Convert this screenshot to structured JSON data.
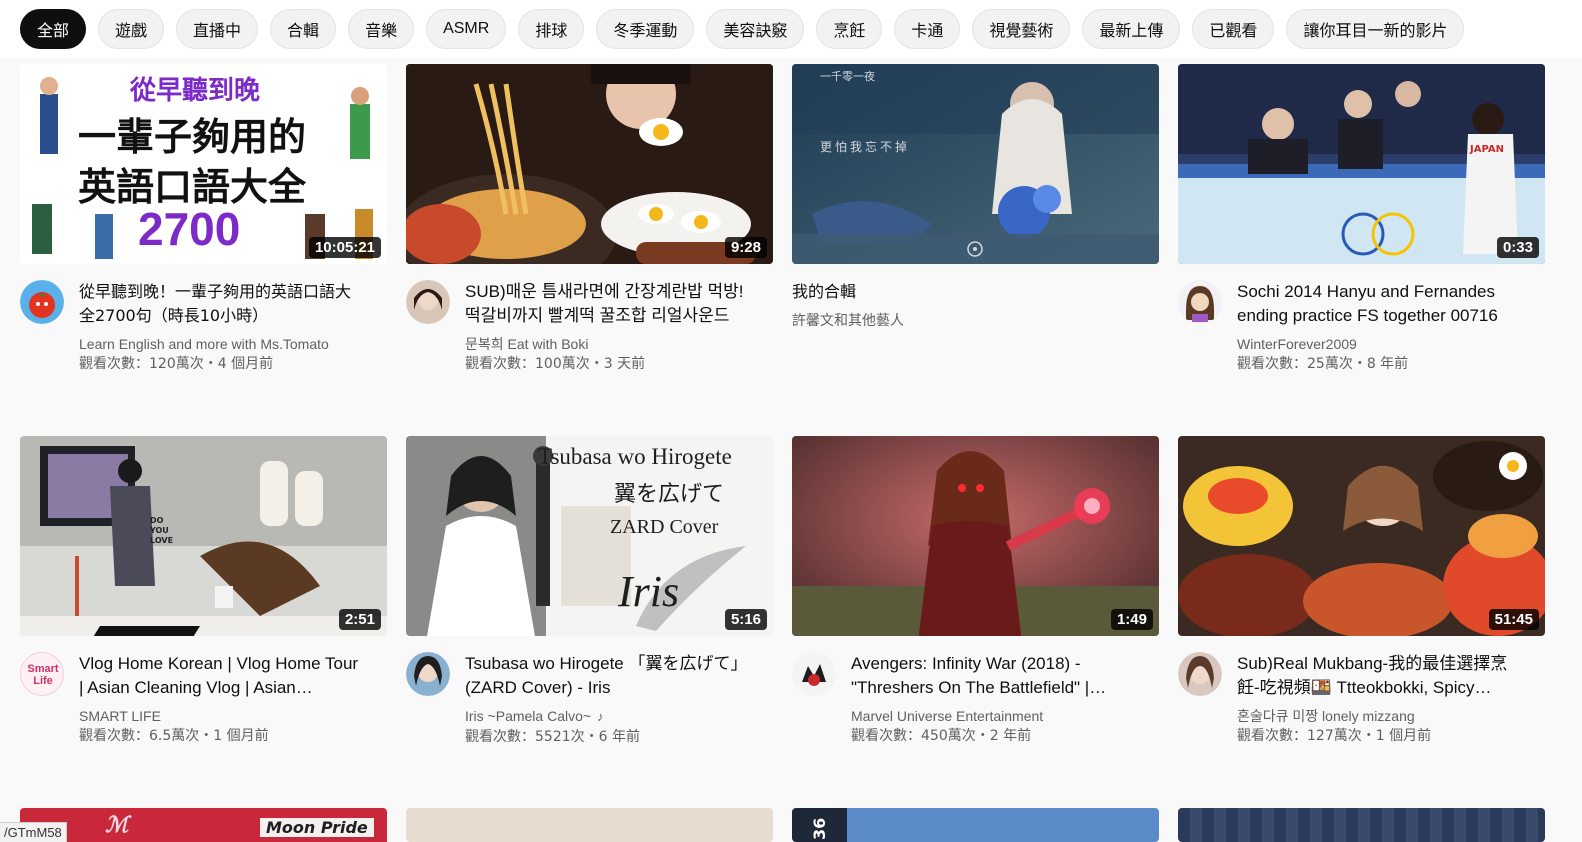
{
  "chips": [
    {
      "label": "全部",
      "active": true
    },
    {
      "label": "遊戲"
    },
    {
      "label": "直播中"
    },
    {
      "label": "合輯"
    },
    {
      "label": "音樂"
    },
    {
      "label": "ASMR"
    },
    {
      "label": "排球"
    },
    {
      "label": "冬季運動"
    },
    {
      "label": "美容訣竅"
    },
    {
      "label": "烹飪"
    },
    {
      "label": "卡通"
    },
    {
      "label": "視覺藝術"
    },
    {
      "label": "最新上傳"
    },
    {
      "label": "已觀看"
    },
    {
      "label": "讓你耳目一新的影片"
    }
  ],
  "videos": [
    {
      "title": "從早聽到晚！一輩子夠用的英語口語大全2700句（時長10小時）",
      "channel": "Learn English and more with Ms.Tomato",
      "stats": "觀看次數：120萬次・4 個月前",
      "duration": "10:05:21",
      "thumb_text": [
        "從早聽到晚",
        "一輩子夠用的",
        "英語口語大全",
        "2700"
      ]
    },
    {
      "title": "SUB)매운 틈새라면에 간장계란밥 먹방! 떡갈비까지 빨계떡 꿀조합 리얼사운드",
      "channel": "문복희 Eat with Boki",
      "stats": "觀看次數：100萬次・3 天前",
      "duration": "9:28"
    },
    {
      "title": "我的合輯",
      "channel": "許馨文和其他藝人",
      "stats": "",
      "duration": "",
      "thumb_text": [
        "一千零一夜",
        "更怕我忘不掉"
      ]
    },
    {
      "title": "Sochi 2014 Hanyu and Fernandes ending practice FS together 00716",
      "channel": "WinterForever2009",
      "stats": "觀看次數：25萬次・8 年前",
      "duration": "0:33",
      "thumb_text": [
        "JAPAN"
      ]
    },
    {
      "title": "Vlog Home Korean | Vlog Home Tour | Asian Cleaning Vlog | Asian Housewife",
      "channel": "SMART LIFE",
      "stats": "觀看次數：6.5萬次・1 個月前",
      "duration": "2:51",
      "thumb_text": [
        "DO",
        "YOU",
        "LOVE"
      ],
      "avatar_text": [
        "Smart",
        "Life"
      ]
    },
    {
      "title": "Tsubasa wo Hirogete 「翼を広げて」(ZARD Cover) - Iris",
      "channel": "Iris ~Pamela Calvo~",
      "stats": "觀看次數：5521次・6 年前",
      "duration": "5:16",
      "thumb_text": [
        "Tsubasa wo Hirogete",
        "翼を広げて",
        "ZARD Cover",
        "Iris"
      ]
    },
    {
      "title": "Avengers: Infinity War (2018) - \"Threshers On The Battlefield\" | Movie Clip",
      "channel": "Marvel Universe Entertainment",
      "stats": "觀看次數：450萬次・2 年前",
      "duration": "1:49"
    },
    {
      "title": "Sub)Real Mukbang-我的最佳選擇烹飪-吃視頻🍱 Ttteokbokki, Spicy Chicken",
      "channel": "혼술다큐 미짱 lonely mizzang",
      "stats": "觀看次數：127萬次・1 個月前",
      "duration": "51:45"
    }
  ],
  "bottom_row_text": [
    "Moon Pride",
    "36"
  ],
  "status_url": "/GTmM58"
}
